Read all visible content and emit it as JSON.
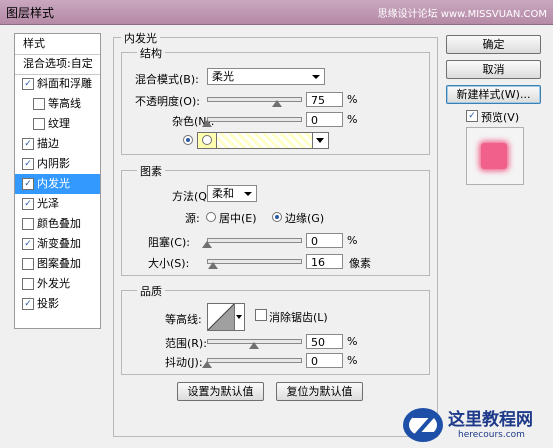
{
  "window": {
    "title": "图层样式",
    "watermark": "思缘设计论坛 www.MISSVUAN.COM"
  },
  "left_panel": {
    "header": "样式",
    "blend_options": "混合选项:自定",
    "items": [
      {
        "label": "斜面和浮雕",
        "checked": true,
        "indent": false
      },
      {
        "label": "等高线",
        "checked": false,
        "indent": true
      },
      {
        "label": "纹理",
        "checked": false,
        "indent": true
      },
      {
        "label": "描边",
        "checked": true,
        "indent": false
      },
      {
        "label": "内阴影",
        "checked": true,
        "indent": false
      },
      {
        "label": "内发光",
        "checked": true,
        "indent": false,
        "selected": true
      },
      {
        "label": "光泽",
        "checked": true,
        "indent": false
      },
      {
        "label": "颜色叠加",
        "checked": false,
        "indent": false
      },
      {
        "label": "渐变叠加",
        "checked": true,
        "indent": false
      },
      {
        "label": "图案叠加",
        "checked": false,
        "indent": false
      },
      {
        "label": "外发光",
        "checked": false,
        "indent": false
      },
      {
        "label": "投影",
        "checked": true,
        "indent": false
      }
    ]
  },
  "inner_glow": {
    "title": "内发光",
    "structure": {
      "title": "结构",
      "blend_mode_label": "混合模式(B):",
      "blend_mode_value": "柔光",
      "opacity_label": "不透明度(O):",
      "opacity_value": "75",
      "noise_label": "杂色(N):",
      "noise_value": "0",
      "unit": "%",
      "opacity_fraction": 0.75,
      "noise_fraction": 0.0,
      "swatch_color": "#ffffb0"
    },
    "elements": {
      "title": "图素",
      "technique_label": "方法(Q):",
      "technique_value": "柔和",
      "source_label": "源:",
      "source_center": "居中(E)",
      "source_edge": "边缘(G)",
      "choke_label": "阻塞(C):",
      "choke_value": "0",
      "size_label": "大小(S):",
      "size_value": "16",
      "size_unit": "像素",
      "unit": "%",
      "choke_fraction": 0.0,
      "size_fraction": 0.065
    },
    "quality": {
      "title": "品质",
      "contour_label": "等高线:",
      "anti_alias_label": "消除锯齿(L)",
      "range_label": "范围(R):",
      "range_value": "50",
      "jitter_label": "抖动(J):",
      "jitter_value": "0",
      "unit": "%",
      "range_fraction": 0.5,
      "jitter_fraction": 0.0
    },
    "make_default": "设置为默认值",
    "reset_default": "复位为默认值"
  },
  "right_panel": {
    "ok": "确定",
    "cancel": "取消",
    "new_style": "新建样式(W)...",
    "preview_label": "预览(V)",
    "preview_checked": true,
    "preview_color": "#f0608a"
  },
  "site_logo": {
    "text": "这里教程网",
    "url_text": "herecours.com"
  },
  "colors": {
    "selection": "#3399ff",
    "title_bar": "#b58aa6"
  }
}
